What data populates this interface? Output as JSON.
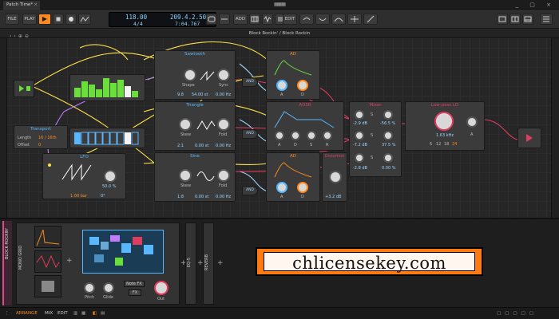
{
  "window": {
    "tab_title": "Patch Time*",
    "close_glyph": "×",
    "logo_glyph": "▦▦▦",
    "controls": "_ ▢ ×"
  },
  "toolbar": {
    "file_label": "FILE",
    "play_label": "PLAY",
    "play_glyph": "▶",
    "tempo": "118.00",
    "time_signature": "4/4",
    "position": "209.4.2.50",
    "time": "7:04.767",
    "add_label": "ADD",
    "edit_label": "EDIT"
  },
  "breadcrumb": "Block Rockin' / Block Rockin",
  "modules": {
    "sawtooth": {
      "title": "Sawtooth",
      "shape": "Shape",
      "sync": "Sync",
      "val1": "9.8",
      "val2": "54.00 st",
      "val3": "0.00 Hz"
    },
    "triangle": {
      "title": "Triangle",
      "skew": "Skew",
      "fold": "Fold",
      "val1": "2:1",
      "val2": "0.00 st",
      "val3": "0.00 Hz"
    },
    "sine": {
      "title": "Sine",
      "skew": "Skew",
      "fold": "Fold",
      "val1": "1:8",
      "val2": "0.00 st",
      "val3": "0.00 Hz"
    },
    "ad1": {
      "title": "AD",
      "a": "A",
      "d": "D"
    },
    "adsr": {
      "title": "ADSR",
      "a": "A",
      "d": "D",
      "s": "S",
      "r": "R"
    },
    "ad2": {
      "title": "AD",
      "a": "A",
      "d": "D"
    },
    "distortion": {
      "title": "Distortion",
      "val": "+3.2 dB"
    },
    "mixer": {
      "title": "Mixer",
      "v1": "-2.9 dB",
      "v2": "-56.5 %",
      "v3": "-7.2 dB",
      "v4": "37.5 %",
      "v5": "-2.8 dB",
      "v6": "0.00 %",
      "s": "S"
    },
    "lowpass": {
      "title": "Low-pass LD",
      "freq": "1.63 kHz",
      "a": "A",
      "slopes": [
        "6",
        "12",
        "18",
        "24"
      ]
    },
    "transport": {
      "title": "Transport",
      "length_label": "Length",
      "length_val": "16 / 16th",
      "offset_label": "Offset",
      "offset_val": "0"
    },
    "lfo": {
      "title": "LFO",
      "val1": "50.0 %",
      "rate": "1.00 bar",
      "phase": "0°"
    },
    "and_label": "AND"
  },
  "device_panel": {
    "track_name": "BLOCK ROCKIN'",
    "polygrid": "MONO GRID",
    "pitch": "Pitch",
    "glide": "Glide",
    "out": "Out",
    "note_fx": "Note FX",
    "fx": "FX",
    "eq": "EQ-5",
    "reverb": "REVERB"
  },
  "statusbar": {
    "arrange": "ARRANGE",
    "mix": "MIX",
    "edit": "EDIT"
  },
  "watermark": "chlicensekey.com",
  "colors": {
    "accent": "#ff8a1e",
    "blue": "#58b7ff",
    "pink": "#e03c5e",
    "yellow": "#ffe14a",
    "green": "#6adf3a",
    "purple": "#c27bff"
  }
}
